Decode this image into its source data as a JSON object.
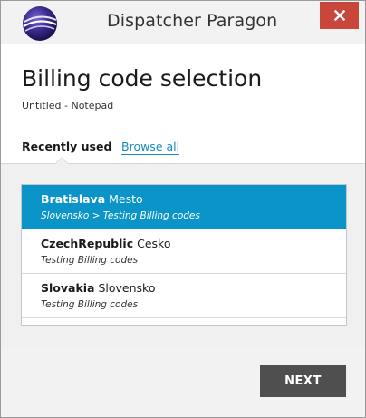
{
  "window": {
    "app_title": "Dispatcher Paragon",
    "close_icon": "close-icon"
  },
  "header": {
    "title": "Billing code selection",
    "subtitle": "Untitled - Notepad"
  },
  "tabs": {
    "recent_label": "Recently used",
    "browse_label": "Browse all"
  },
  "billing_codes": [
    {
      "name": "Bratislava",
      "description": "Mesto",
      "path": "Slovensko > Testing Billing codes",
      "selected": true
    },
    {
      "name": "CzechRepublic",
      "description": "Cesko",
      "path": "Testing Billing codes",
      "selected": false
    },
    {
      "name": "Slovakia",
      "description": "Slovensko",
      "path": "Testing Billing codes",
      "selected": false
    }
  ],
  "footer": {
    "next_label": "NEXT"
  },
  "colors": {
    "selected_bg": "#0a94c8",
    "link": "#1a86c8",
    "close_bg": "#c8473a",
    "button_bg": "#4f4f4f"
  }
}
